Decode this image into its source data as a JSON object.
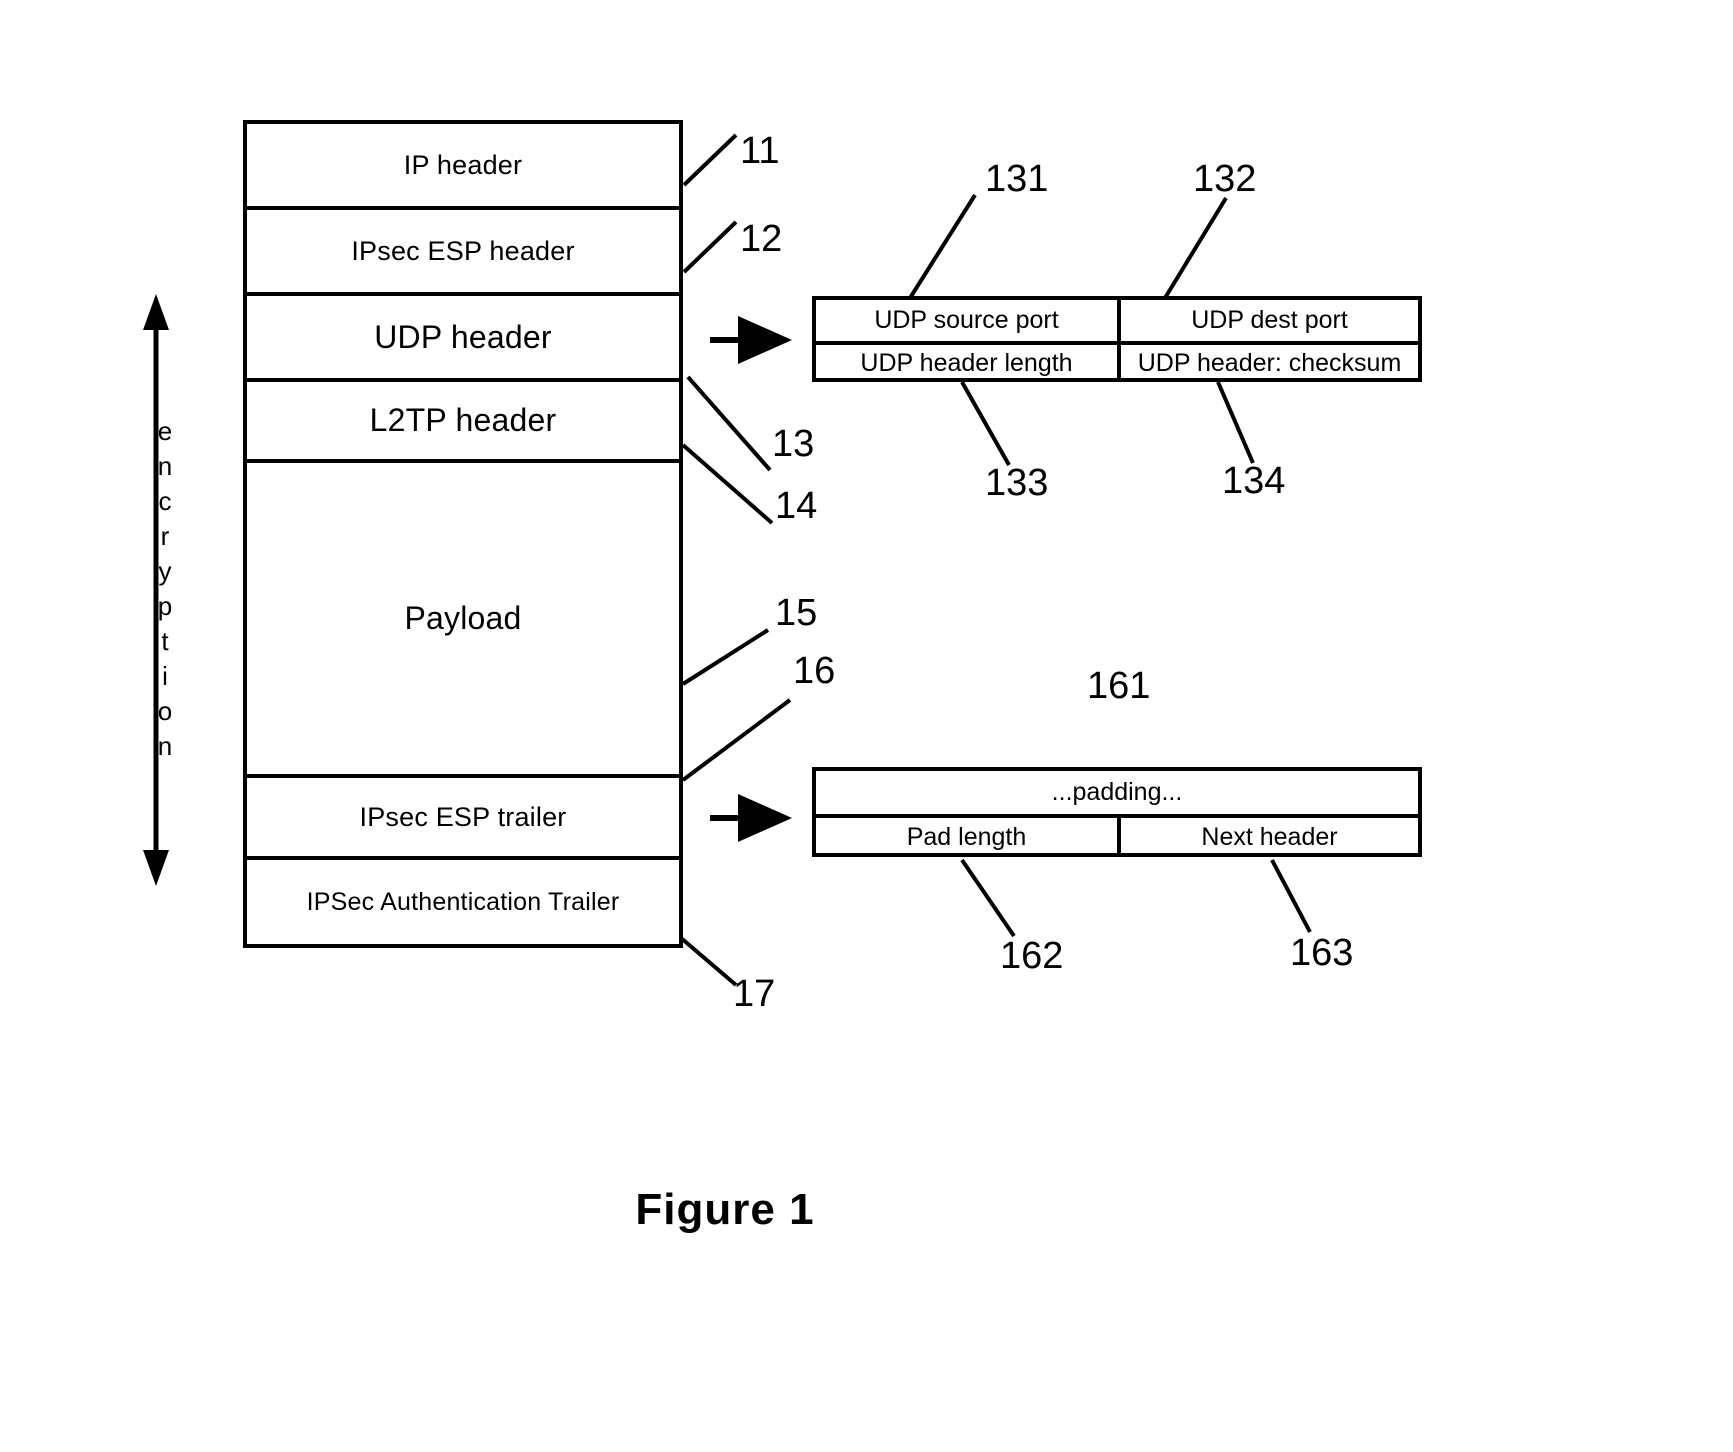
{
  "figure": {
    "caption": "Figure 1"
  },
  "encryption_axis": {
    "label": "encryption",
    "letters": [
      "e",
      "n",
      "c",
      "r",
      "y",
      "p",
      "t",
      "i",
      "o",
      "n"
    ],
    "arrow_top_name": "arrow-up",
    "arrow_bottom_name": "arrow-down"
  },
  "packet_stack": {
    "name": "ipsec-l2tp-packet-stack",
    "rows": [
      {
        "label": "IP header",
        "ref": "11"
      },
      {
        "label": "IPsec ESP header",
        "ref": "12"
      },
      {
        "label": "UDP header",
        "ref": "13"
      },
      {
        "label": "L2TP header",
        "ref": "14"
      },
      {
        "label": "Payload",
        "ref": "15"
      },
      {
        "label": "IPsec ESP trailer",
        "ref": "16"
      },
      {
        "label": "IPSec Authentication Trailer",
        "ref": "17"
      }
    ]
  },
  "udp_detail": {
    "name": "udp-header-detail",
    "cells": [
      {
        "label": "UDP source port",
        "ref": "131"
      },
      {
        "label": "UDP dest port",
        "ref": "132"
      },
      {
        "label": "UDP header length",
        "ref": "133"
      },
      {
        "label": "UDP header: checksum",
        "ref": "134"
      }
    ]
  },
  "esp_trailer_detail": {
    "name": "esp-trailer-detail",
    "cells": [
      {
        "label": "...padding...",
        "ref": "161"
      },
      {
        "label": "Pad length",
        "ref": "162"
      },
      {
        "label": "Next header",
        "ref": "163"
      }
    ]
  },
  "reference_numerals": {
    "r11": "11",
    "r12": "12",
    "r13": "13",
    "r14": "14",
    "r15": "15",
    "r16": "16",
    "r17": "17",
    "r131": "131",
    "r132": "132",
    "r133": "133",
    "r134": "134",
    "r161": "161",
    "r162": "162",
    "r163": "163"
  },
  "colors": {
    "ink": "#000000",
    "background": "#ffffff"
  }
}
